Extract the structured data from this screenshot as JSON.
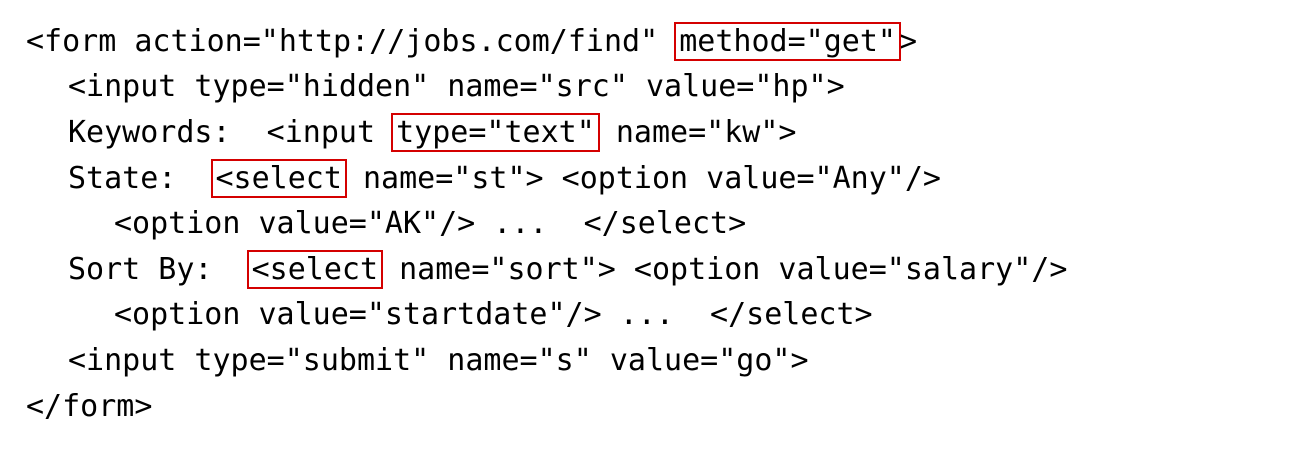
{
  "code_lines": [
    {
      "pre": "<form action=\"http://jobs.com/find\" ",
      "highlight": "method=\"get\"",
      "post": ">"
    },
    {
      "text": "<input type=\"hidden\" name=\"src\" value=\"hp\">"
    },
    {
      "pre": "Keywords:  <input ",
      "highlight": "type=\"text\"",
      "post": " name=\"kw\">"
    },
    {
      "pre": "State:  ",
      "highlight": "<select",
      "post": " name=\"st\"> <option value=\"Any\"/>"
    },
    {
      "text": "<option value=\"AK\"/> ...  </select>"
    },
    {
      "pre": "Sort By:  ",
      "highlight": "<select",
      "post": " name=\"sort\"> <option value=\"salary\"/>"
    },
    {
      "text": "<option value=\"startdate\"/> ...  </select>"
    },
    {
      "text": "<input type=\"submit\" name=\"s\" value=\"go\">"
    },
    {
      "text": "</form>"
    }
  ],
  "colors": {
    "highlight_box": "#d40000",
    "text": "#000000",
    "background": "#ffffff"
  }
}
